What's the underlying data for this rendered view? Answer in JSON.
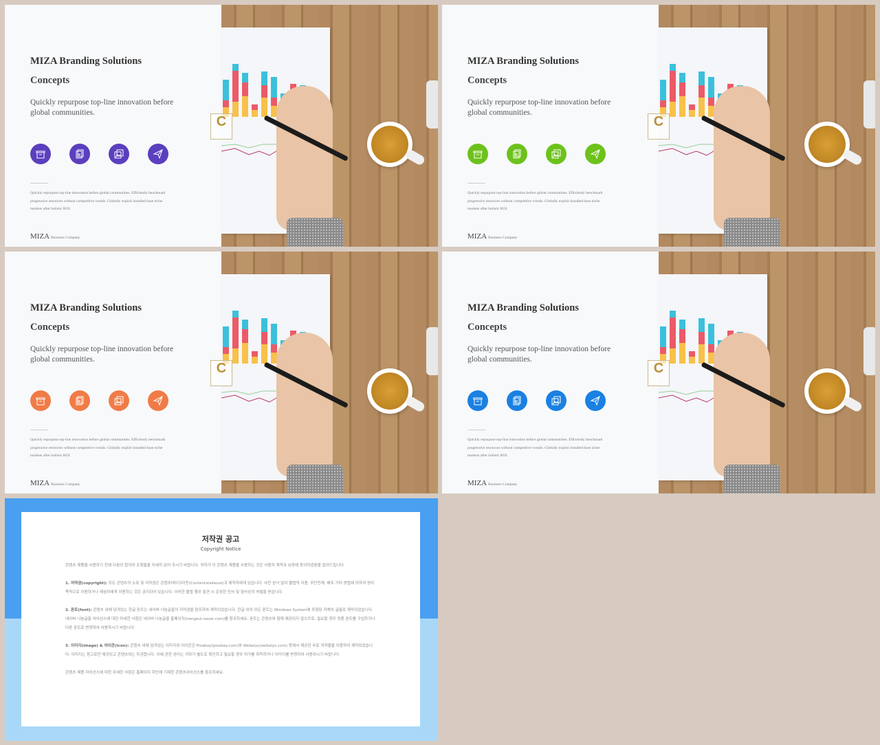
{
  "slides": [
    {
      "title": "MIZA Branding Solutions",
      "subtitle": "Concepts",
      "description": "Quickly repurpose top-line innovation before global communities.",
      "body": "Quickly repurpose top-line innovation before global communities. Efficiently benchmark progressive resources without competitive vortals. Globally exploit installed base niche markets after holistic ROI.",
      "brand": "MIZA",
      "brand_sub": "Business Company",
      "accent": "#5a3fbe"
    },
    {
      "title": "MIZA Branding Solutions",
      "subtitle": "Concepts",
      "description": "Quickly repurpose top-line innovation before global communities.",
      "body": "Quickly repurpose top-line innovation before global communities. Efficiently benchmark progressive resources without competitive vortals. Globally exploit installed base niche markets after holistic ROI.",
      "brand": "MIZA",
      "brand_sub": "Business Company",
      "accent": "#6cc21b"
    },
    {
      "title": "MIZA Branding Solutions",
      "subtitle": "Concepts",
      "description": "Quickly repurpose top-line innovation before global communities.",
      "body": "Quickly repurpose top-line innovation before global communities. Efficiently benchmark progressive resources without competitive vortals. Globally exploit installed base niche markets after holistic ROI.",
      "brand": "MIZA",
      "brand_sub": "Business Company",
      "accent": "#f07b47"
    },
    {
      "title": "MIZA Branding Solutions",
      "subtitle": "Concepts",
      "description": "Quickly repurpose top-line innovation before global communities.",
      "body": "Quickly repurpose top-line innovation before global communities. Efficiently benchmark progressive resources without competitive vortals. Globally exploit installed base niche markets after holistic ROI.",
      "brand": "MIZA",
      "brand_sub": "Business Company",
      "accent": "#1a80e2"
    }
  ],
  "icons": [
    "archive-box-icon",
    "documents-icon",
    "image-gallery-icon",
    "paper-plane-icon"
  ],
  "photo_logo": "C",
  "notice": {
    "title": "저작권 공고",
    "subtitle": "Copyright Notice",
    "intro": "콘텐츠 제품을 사용하기 전에 다음의 합의와 조항들을 자세히 읽어 주시기 바랍니다. 귀하가 이 콘텐츠 제품을 사용하는 것은 사용자 계약과 보증에 동의하셨음을 알려드립니다.",
    "s1_head": "1. 저작권(copyright):",
    "s1": "모든 콘텐츠의 소유 및 저작권은 콘텐츠테이크아웃(Contentstakeout)과 제작자에게 있습니다. 사전 승낙 없이 불법적 이용, 무단전재, 배포 기타 방법에 의하여 영리 목적으로 이용하거나 제삼자에게 이용하는 것은 금지되어 있습니다. 이러한 불법 행위 발견 시 준엄한 민사 및 형사상의 처벌을 받습니다.",
    "s2_head": "2. 폰트(font):",
    "s2": "콘텐츠 내에 담겨있는 한글 폰트는 네이버 나눔글꼴의 저작권을 참조하여 제작되었습니다. 한글 외의 모든 폰트는 Windows System에 포함된 자체의 글꼴로 제작되었습니다. 네이버 나눔글꼴 라이선스에 대한 자세한 사항은 네이버 나눔글꼴 홈페이지(hangeul.naver.com)를 참조하세요. 폰트는 콘텐츠와 함께 제공되지 않으므로, 필요할 경우 정품 폰트를 구입하거나 다른 폰트로 변경하여 사용하시기 바랍니다.",
    "s3_head": "3. 이미지(image) & 아이콘(icon):",
    "s3": "콘텐츠 내에 담겨있는 이미지와 아이콘은 Pixabay(pixabay.com)와 Webalys(webalys.com) 등에서 제공한 무료 저작물을 이용하여 제작되었습니다. 이미지는 참고로만 제공되고 콘텐츠와는 무관합니다. 이에 관한 권리는 귀하가 별도로 확인하고 필요할 경우 허가를 취득하거나 이미지를 변경하여 사용하시기 바랍니다.",
    "outro": "콘텐츠 제품 라이선스에 대한 자세한 사항은 홈페이지 하단에 기재한 콘텐츠라이선스를 참조하세요."
  }
}
